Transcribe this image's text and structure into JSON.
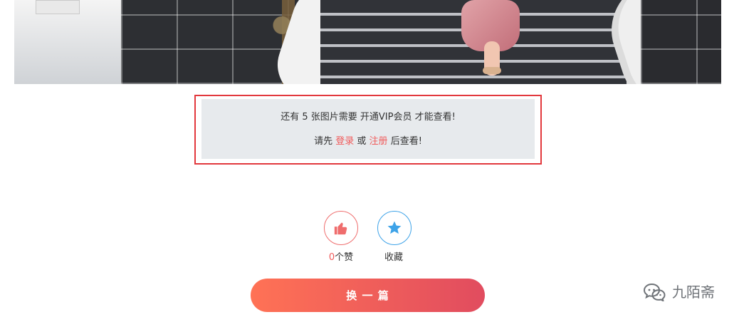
{
  "prompt": {
    "line1": "还有 5 张图片需要 开通VIP会员 才能查看!",
    "line2_prefix": "请先",
    "login": "登录",
    "or": "或",
    "register": "注册",
    "line2_suffix": "后查看!"
  },
  "actions": {
    "like_count": "0",
    "like_suffix": "个赞",
    "favorite": "收藏"
  },
  "cta": {
    "label": "换 一 篇"
  },
  "watermark": {
    "text": "九陌斋"
  },
  "colors": {
    "danger_border": "#e2383d",
    "link_red": "#f05a5a",
    "like_red": "#ef6d6d",
    "fav_blue": "#3ea3e8",
    "cta_start": "#ff7255",
    "cta_end": "#e14c5f"
  }
}
